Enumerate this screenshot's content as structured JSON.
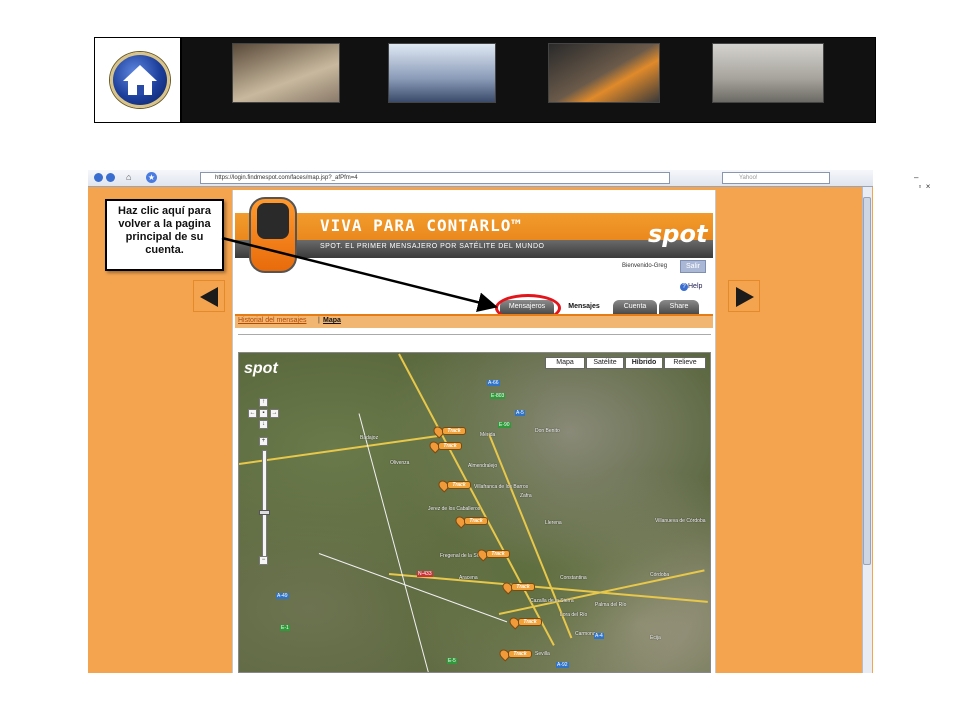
{
  "banner": {
    "home_label": "Home"
  },
  "browser": {
    "url": "https://login.findmespot.com/faces/map.jsp?_afPfm=4",
    "search_placeholder": "Yahoo!"
  },
  "spot": {
    "headline": "VIVA PARA CONTARLO™",
    "tagline": "SPOT. EL PRIMER MENSAJERO POR SATÉLITE DEL MUNDO",
    "logo_text": "spot",
    "welcome": "Bienvenido-Greg",
    "logout_label": "Salir",
    "help_label": "Help",
    "tabs": [
      {
        "label": "Mensajeros"
      },
      {
        "label": "Mensajes"
      },
      {
        "label": "Cuenta"
      },
      {
        "label": "Share"
      }
    ],
    "subnav": {
      "history_link": "Historial del mensajes",
      "separator": "|",
      "current": "Mapa"
    }
  },
  "map": {
    "type_buttons": [
      "Mapa",
      "Satélite",
      "Híbrido",
      "Relieve"
    ],
    "selected_type": "Híbrido",
    "marker_label": "Track",
    "towns": [
      "Mérida",
      "Almendralejo",
      "Villafranca de los Barros",
      "Jerez de los Caballeros",
      "Fregenal de la Sierra",
      "Aracena",
      "Constantina",
      "Córdoba",
      "Cazalla de la Sierra",
      "Sevilla",
      "Don Benito",
      "Zafra",
      "Llerena",
      "Badajoz",
      "Olivenza",
      "Carmona",
      "Écija",
      "Palma del Río",
      "Villanueva de Córdoba",
      "Lora del Río"
    ],
    "shields": [
      "A-66",
      "E-803",
      "A-5",
      "E-90",
      "N-433",
      "A-4",
      "E-5",
      "A-49",
      "E-1",
      "A-92"
    ]
  },
  "callout": {
    "text": "Haz clic aquí para volver a la pagina principal de su cuenta."
  }
}
